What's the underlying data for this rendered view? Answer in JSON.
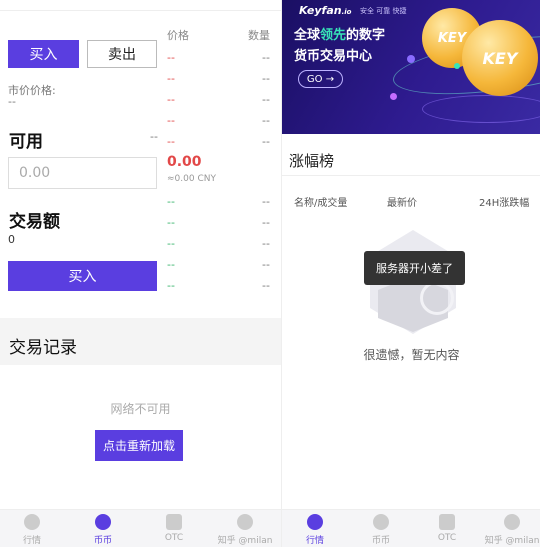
{
  "trade": {
    "buy_tab": "买入",
    "sell_tab": "卖出",
    "market_price_label": "市价价格:",
    "market_price_value": "--",
    "available_label": "可用",
    "available_value": "--",
    "price_input_placeholder": "0.00",
    "amount_label": "交易额",
    "amount_value": "0",
    "buy_button": "买入"
  },
  "orderbook": {
    "price_header": "价格",
    "qty_header": "数量",
    "asks": [
      {
        "price": "--",
        "qty": "--"
      },
      {
        "price": "--",
        "qty": "--"
      },
      {
        "price": "--",
        "qty": "--"
      },
      {
        "price": "--",
        "qty": "--"
      },
      {
        "price": "--",
        "qty": "--"
      }
    ],
    "last_price": "0.00",
    "last_price_cny": "≈0.00 CNY",
    "bids": [
      {
        "price": "--",
        "qty": "--"
      },
      {
        "price": "--",
        "qty": "--"
      },
      {
        "price": "--",
        "qty": "--"
      },
      {
        "price": "--",
        "qty": "--"
      },
      {
        "price": "--",
        "qty": "--"
      }
    ]
  },
  "records": {
    "title": "交易记录",
    "network_msg": "网络不可用",
    "reload_button": "点击重新加载"
  },
  "tabbar_left": {
    "tabs": [
      "行情",
      "币币",
      "OTC",
      "我的"
    ],
    "active": "币币"
  },
  "tabbar_right": {
    "tabs": [
      "行情",
      "币币",
      "OTC",
      "我的"
    ],
    "active": "行情"
  },
  "watermark": "知乎 @milan",
  "banner": {
    "brand": "Keyfan",
    "brand_suffix": ".io",
    "tags": "安全  可靠  快捷",
    "line1_a": "全球",
    "line1_hl": "领先",
    "line1_b": "的数字",
    "line2": "货币交易中心",
    "go": "GO →",
    "coin_text": "KEY"
  },
  "ranking": {
    "title": "涨幅榜",
    "col_name": "名称/成交量",
    "col_price": "最新价",
    "col_change": "24H涨跌幅",
    "toast": "服务器开小差了",
    "empty_msg": "很遗憾，暂无内容"
  },
  "colors": {
    "accent": "#5a3ee0",
    "ask_red": "#e24848",
    "bid_green": "#36b36a",
    "banner_bg": "#2e1b8f",
    "highlight_teal": "#37e4b8"
  }
}
